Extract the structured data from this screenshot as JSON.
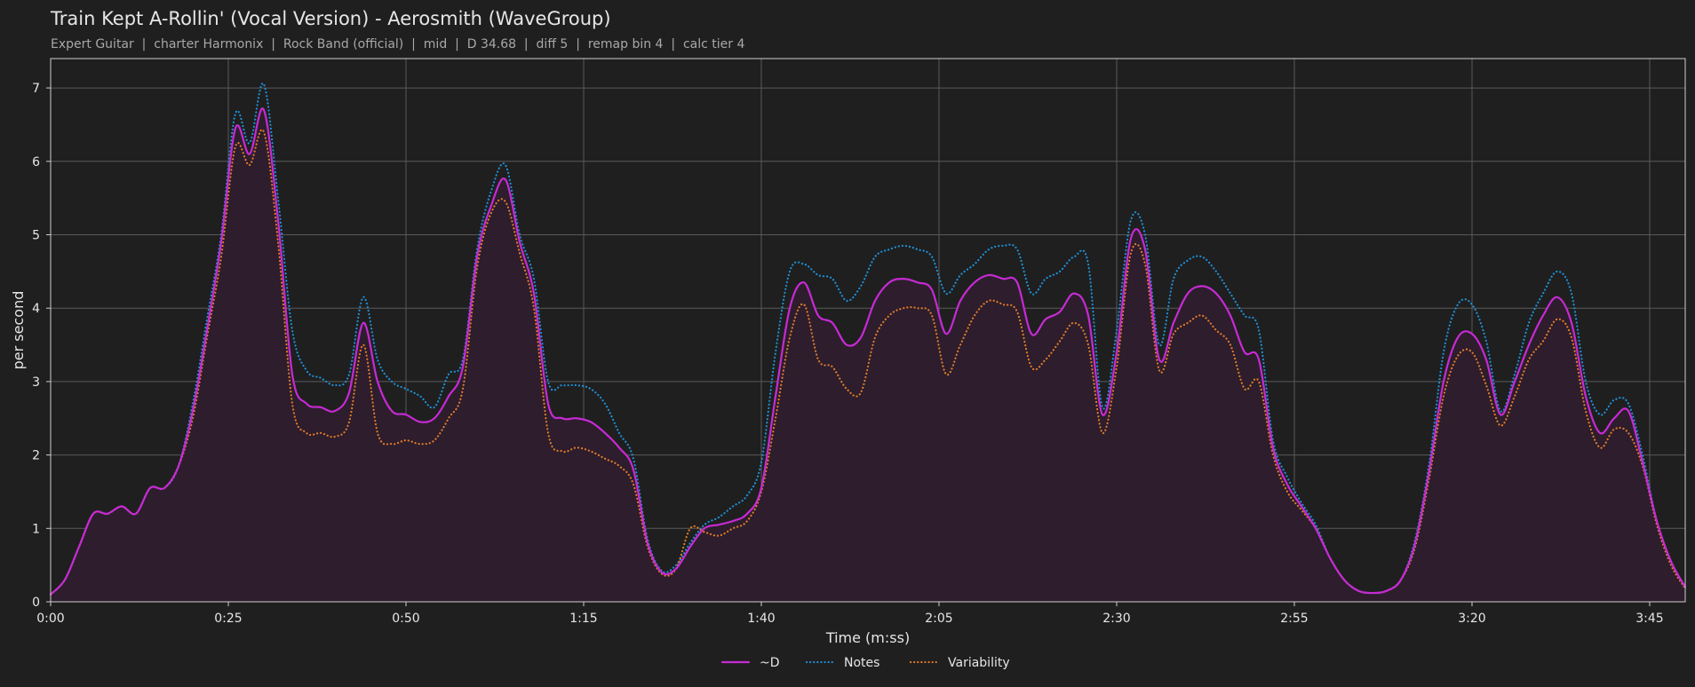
{
  "title": "Train Kept A-Rollin' (Vocal Version) - Aerosmith (WaveGroup)",
  "subtitle": "Expert Guitar  |  charter Harmonix  |  Rock Band (official)  |  mid  |  D 34.68  |  diff 5  |  remap bin 4  |  calc tier 4",
  "colors": {
    "background": "#1f1f1f",
    "grid": "#5a5a5a",
    "axis": "#cfcfcf",
    "text": "#e6e6e6",
    "subtext": "#a8a8a8",
    "d": "#c72ad4",
    "notes": "#1f8fd6",
    "variability": "#e07b28",
    "fill": "#2d1d2d"
  },
  "chart_data": {
    "type": "line",
    "title": "Train Kept A-Rollin' (Vocal Version) - Aerosmith (WaveGroup)",
    "xlabel": "Time (m:ss)",
    "ylabel": "per second",
    "xlim": [
      0,
      230
    ],
    "ylim": [
      0,
      7.4
    ],
    "grid": true,
    "legend_position": "bottom-center",
    "x_ticks": [
      0,
      25,
      50,
      75,
      100,
      125,
      150,
      175,
      200,
      225
    ],
    "x_tick_labels": [
      "0:00",
      "0:25",
      "0:50",
      "1:15",
      "1:40",
      "2:05",
      "2:30",
      "2:55",
      "3:20",
      "3:45"
    ],
    "y_ticks": [
      0,
      1,
      2,
      3,
      4,
      5,
      6,
      7
    ],
    "y_tick_labels": [
      "0",
      "1",
      "2",
      "3",
      "4",
      "5",
      "6",
      "7"
    ],
    "x": [
      0,
      2,
      4,
      6,
      8,
      10,
      12,
      14,
      16,
      18,
      20,
      22,
      24,
      26,
      28,
      30,
      32,
      34,
      36,
      38,
      40,
      42,
      44,
      46,
      48,
      50,
      52,
      54,
      56,
      58,
      60,
      62,
      64,
      66,
      68,
      70,
      72,
      74,
      76,
      78,
      80,
      82,
      84,
      86,
      88,
      90,
      92,
      94,
      96,
      98,
      100,
      102,
      104,
      106,
      108,
      110,
      112,
      114,
      116,
      118,
      120,
      122,
      124,
      126,
      128,
      130,
      132,
      134,
      136,
      138,
      140,
      142,
      144,
      146,
      148,
      150,
      152,
      154,
      156,
      158,
      160,
      162,
      164,
      166,
      168,
      170,
      172,
      174,
      176,
      178,
      180,
      182,
      184,
      186,
      188,
      190,
      192,
      194,
      196,
      198,
      200,
      202,
      204,
      206,
      208,
      210,
      212,
      214,
      216,
      218,
      220,
      222,
      224,
      226,
      228,
      230
    ],
    "series": [
      {
        "name": "~D",
        "style": "solid",
        "values": [
          0.1,
          0.3,
          0.75,
          1.2,
          1.2,
          1.3,
          1.2,
          1.55,
          1.55,
          1.85,
          2.6,
          3.7,
          4.9,
          6.45,
          6.1,
          6.7,
          5.2,
          3.1,
          2.7,
          2.65,
          2.6,
          2.85,
          3.8,
          3.0,
          2.6,
          2.55,
          2.45,
          2.5,
          2.8,
          3.2,
          4.7,
          5.4,
          5.75,
          4.9,
          4.2,
          2.7,
          2.5,
          2.5,
          2.45,
          2.3,
          2.1,
          1.8,
          0.8,
          0.4,
          0.45,
          0.75,
          1.0,
          1.05,
          1.1,
          1.2,
          1.55,
          2.8,
          4.0,
          4.35,
          3.9,
          3.8,
          3.5,
          3.6,
          4.1,
          4.35,
          4.4,
          4.35,
          4.25,
          3.65,
          4.1,
          4.35,
          4.45,
          4.4,
          4.35,
          3.65,
          3.85,
          3.95,
          4.2,
          3.9,
          2.55,
          3.4,
          4.95,
          4.8,
          3.3,
          3.8,
          4.2,
          4.3,
          4.2,
          3.9,
          3.4,
          3.3,
          2.1,
          1.6,
          1.3,
          1.0,
          0.6,
          0.3,
          0.15,
          0.12,
          0.15,
          0.3,
          0.8,
          1.8,
          3.0,
          3.6,
          3.65,
          3.3,
          2.55,
          3.0,
          3.5,
          3.9,
          4.15,
          3.8,
          2.8,
          2.3,
          2.5,
          2.6,
          1.9,
          1.1,
          0.55,
          0.2
        ]
      },
      {
        "name": "Notes",
        "style": "dotted",
        "values": [
          0.1,
          0.3,
          0.75,
          1.2,
          1.2,
          1.3,
          1.2,
          1.55,
          1.55,
          1.85,
          2.7,
          3.85,
          5.0,
          6.65,
          6.25,
          7.05,
          5.5,
          3.7,
          3.15,
          3.05,
          2.95,
          3.1,
          4.15,
          3.3,
          3.0,
          2.9,
          2.8,
          2.65,
          3.1,
          3.3,
          4.8,
          5.6,
          5.95,
          5.0,
          4.4,
          3.0,
          2.95,
          2.95,
          2.9,
          2.7,
          2.3,
          1.95,
          0.85,
          0.42,
          0.5,
          0.8,
          1.05,
          1.15,
          1.3,
          1.45,
          1.9,
          3.4,
          4.5,
          4.6,
          4.45,
          4.4,
          4.1,
          4.3,
          4.7,
          4.8,
          4.85,
          4.8,
          4.7,
          4.2,
          4.45,
          4.6,
          4.8,
          4.85,
          4.8,
          4.2,
          4.4,
          4.5,
          4.7,
          4.6,
          2.65,
          3.7,
          5.2,
          5.0,
          3.5,
          4.4,
          4.65,
          4.7,
          4.5,
          4.2,
          3.9,
          3.7,
          2.2,
          1.7,
          1.35,
          1.05,
          0.6,
          0.3,
          0.15,
          0.12,
          0.15,
          0.3,
          0.85,
          1.9,
          3.4,
          4.05,
          4.05,
          3.55,
          2.6,
          3.1,
          3.8,
          4.2,
          4.5,
          4.2,
          3.0,
          2.55,
          2.75,
          2.7,
          2.0,
          1.1,
          0.55,
          0.2
        ]
      },
      {
        "name": "Variability",
        "style": "dotted",
        "values": [
          0.1,
          0.3,
          0.75,
          1.2,
          1.2,
          1.3,
          1.2,
          1.55,
          1.55,
          1.85,
          2.5,
          3.6,
          4.7,
          6.2,
          5.95,
          6.4,
          4.9,
          2.7,
          2.3,
          2.3,
          2.25,
          2.45,
          3.5,
          2.3,
          2.15,
          2.2,
          2.15,
          2.2,
          2.5,
          2.9,
          4.55,
          5.3,
          5.45,
          4.75,
          4.0,
          2.3,
          2.05,
          2.1,
          2.05,
          1.95,
          1.85,
          1.6,
          0.75,
          0.38,
          0.45,
          1.0,
          0.95,
          0.9,
          1.0,
          1.1,
          1.5,
          2.5,
          3.6,
          4.05,
          3.3,
          3.2,
          2.9,
          2.85,
          3.6,
          3.9,
          4.0,
          4.0,
          3.9,
          3.1,
          3.5,
          3.9,
          4.1,
          4.05,
          3.95,
          3.2,
          3.3,
          3.55,
          3.8,
          3.5,
          2.3,
          3.2,
          4.75,
          4.6,
          3.15,
          3.65,
          3.8,
          3.9,
          3.7,
          3.5,
          2.9,
          3.0,
          2.0,
          1.5,
          1.25,
          1.0,
          0.6,
          0.3,
          0.15,
          0.12,
          0.15,
          0.3,
          0.75,
          1.7,
          2.8,
          3.35,
          3.4,
          2.95,
          2.4,
          2.8,
          3.3,
          3.55,
          3.85,
          3.6,
          2.6,
          2.1,
          2.35,
          2.3,
          1.85,
          1.05,
          0.5,
          0.18
        ]
      }
    ]
  }
}
